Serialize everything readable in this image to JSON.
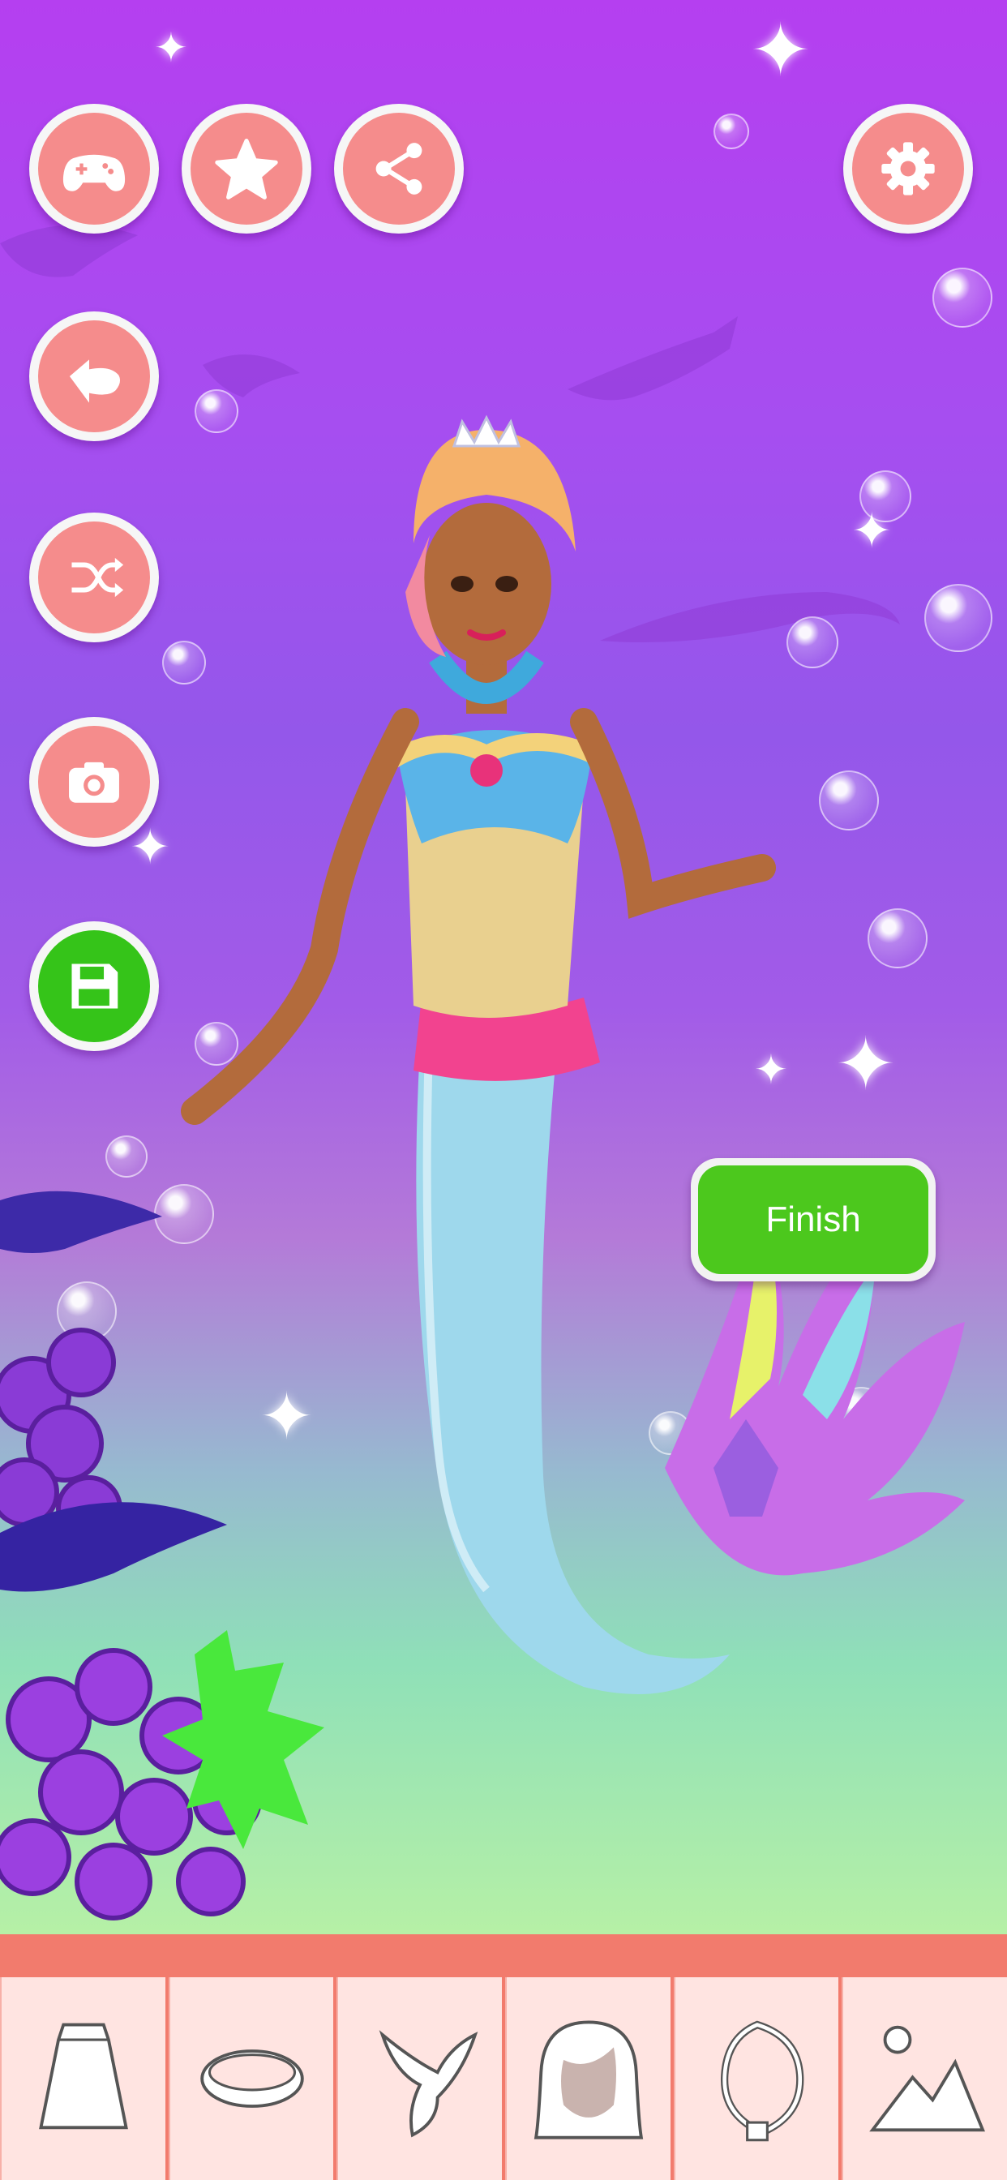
{
  "toolbar": {
    "gamepad": "gamepad-icon",
    "star": "star-icon",
    "share": "share-icon",
    "settings": "gear-icon"
  },
  "side_menu": [
    "back-arrow-icon",
    "shuffle-icon",
    "camera-icon",
    "save-icon"
  ],
  "finish_button": {
    "label": "Finish"
  },
  "category_tabs": [
    "skirt-icon",
    "bracelet-icon",
    "tail-icon",
    "hair-icon",
    "necklace-icon",
    "background-icon"
  ],
  "colors": {
    "button_pink": "#f58c8c",
    "button_green": "#35c419",
    "bar": "#f27b6d",
    "tab_bg": "#ffe4e1"
  }
}
